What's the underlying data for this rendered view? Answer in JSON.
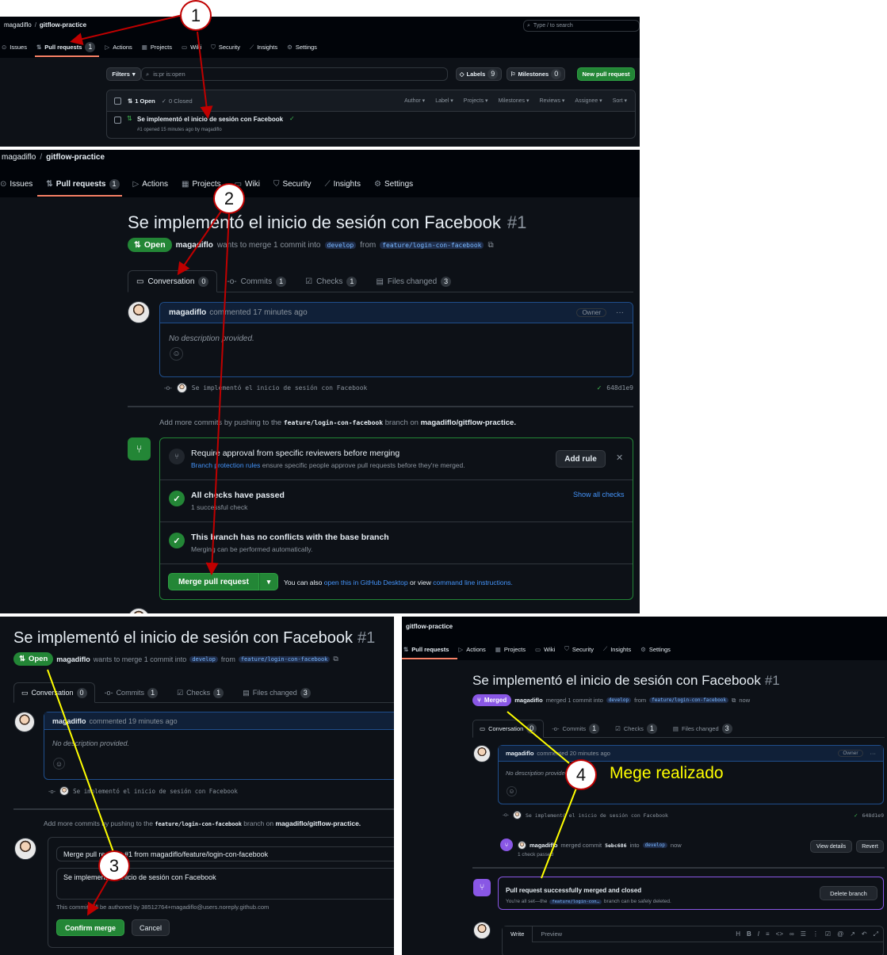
{
  "repo": {
    "owner": "magadiflo",
    "name": "gitflow-practice",
    "separator": "/"
  },
  "nav": {
    "issues": "Issues",
    "pull_requests": "Pull requests",
    "pr_count": "1",
    "actions": "Actions",
    "projects": "Projects",
    "wiki": "Wiki",
    "security": "Security",
    "insights": "Insights",
    "settings": "Settings"
  },
  "search": {
    "placeholder": "Type / to search"
  },
  "list": {
    "filters": "Filters",
    "query": "is:pr is:open",
    "labels": "Labels",
    "labels_count": "9",
    "milestones": "Milestones",
    "milestones_count": "0",
    "new_pr": "New pull request",
    "open": "1 Open",
    "closed": "0 Closed",
    "author": "Author",
    "label": "Label",
    "projects": "Projects",
    "milestones_f": "Milestones",
    "reviews": "Reviews",
    "assignee": "Assignee",
    "sort": "Sort",
    "pr_title": "Se implementó el inicio de sesión con Facebook",
    "pr_meta": "#1 opened 15 minutes ago by magadiflo"
  },
  "pr": {
    "title": "Se implementó el inicio de sesión con Facebook",
    "number": "#1",
    "state_open": "Open",
    "state_merged": "Merged",
    "author": "magadiflo",
    "wants_merge": "wants to merge 1 commit into",
    "merged_text": "merged 1 commit into",
    "base": "develop",
    "from": "from",
    "head": "feature/login-con-facebook",
    "head_short": "feature/login-con…",
    "now": "now",
    "tabs": {
      "conversation": "Conversation",
      "commits": "Commits",
      "checks": "Checks",
      "files": "Files changed"
    },
    "counts": {
      "conversation": "0",
      "commits": "1",
      "checks": "1",
      "files": "3"
    },
    "commented_17": "commented 17 minutes ago",
    "commented_19": "commented 19 minutes ago",
    "commented_20": "commented 20 minutes ago",
    "owner": "Owner",
    "no_description": "No description provided.",
    "commit_msg": "Se implementó el inicio de sesión con Facebook",
    "commit_sha": "648d1e9",
    "add_more_1": "Add more commits by pushing to the",
    "add_more_2": "branch on",
    "add_more_repo": "magadiflo/gitflow-practice.",
    "require_title": "Require approval from specific reviewers before merging",
    "require_link": "Branch protection rules",
    "require_desc": "ensure specific people approve pull requests before they're merged.",
    "add_rule": "Add rule",
    "checks_passed": "All checks have passed",
    "checks_sub": "1 successful check",
    "show_checks": "Show all checks",
    "no_conflicts": "This branch has no conflicts with the base branch",
    "no_conflicts_sub": "Merging can be performed automatically.",
    "merge_btn": "Merge pull request",
    "also_1": "You can also",
    "also_link1": "open this in GitHub Desktop",
    "also_2": "or view",
    "also_link2": "command line instructions.",
    "merge_commit_title": "Merge pull request #1 from magadiflo/feature/login-con-facebook",
    "merge_commit_body": "Se implementó el inicio de sesión con Facebook",
    "authored_by": "This commit will be authored by 38512764+magadiflo@users.noreply.github.com",
    "confirm": "Confirm merge",
    "cancel": "Cancel",
    "merged_commit": "merged commit",
    "merged_sha": "5ebc686",
    "into": "into",
    "one_check": "1 check passed",
    "view_details": "View details",
    "revert": "Revert",
    "success_title": "Pull request successfully merged and closed",
    "success_sub_1": "You're all set—the",
    "success_sub_2": "branch can be safely deleted.",
    "delete_branch": "Delete branch",
    "write": "Write",
    "preview": "Preview"
  },
  "annotations": {
    "step1": "1",
    "step2": "2",
    "step3": "3",
    "step4": "4",
    "step4_label": "Mege realizado"
  },
  "colors": {
    "bg": "#0d1117",
    "green": "#238636",
    "purple": "#8957e5",
    "link": "#4493f8",
    "arrow_red": "#c00000",
    "arrow_yellow": "#ffff00"
  }
}
